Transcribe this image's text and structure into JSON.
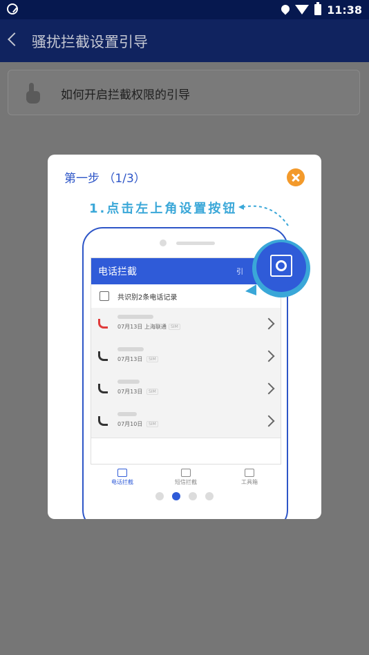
{
  "status_bar": {
    "time": "11:38"
  },
  "app_bar": {
    "title": "骚扰拦截设置引导"
  },
  "guide_card": {
    "text": "如何开启拦截权限的引导"
  },
  "modal": {
    "step_title": "第一步 （1/3）",
    "tip": "1.点击左上角设置按钮",
    "pager": {
      "total": 4,
      "active_index": 1
    }
  },
  "phone_screen": {
    "header_title": "电话拦截",
    "header_right": "引",
    "summary": "共识别2条电话记录",
    "rows": [
      {
        "date": "07月13日 上海联通",
        "tag": "SIM",
        "icon": "blocked-call-icon"
      },
      {
        "date": "07月13日",
        "tag": "SIM",
        "icon": "call-icon"
      },
      {
        "date": "07月13日",
        "tag": "SIM",
        "icon": "call-icon"
      },
      {
        "date": "07月10日",
        "tag": "SIM",
        "icon": "call-icon"
      }
    ],
    "nav": [
      {
        "label": "电话拦截",
        "active": true
      },
      {
        "label": "短信拦截",
        "active": false
      },
      {
        "label": "工具箱",
        "active": false
      }
    ]
  },
  "colors": {
    "status_bar": "#06184f",
    "app_bar": "#10235f",
    "accent_blue": "#2f5bd8",
    "close_orange": "#f39a2b",
    "tip_cyan": "#3aa7d8"
  }
}
